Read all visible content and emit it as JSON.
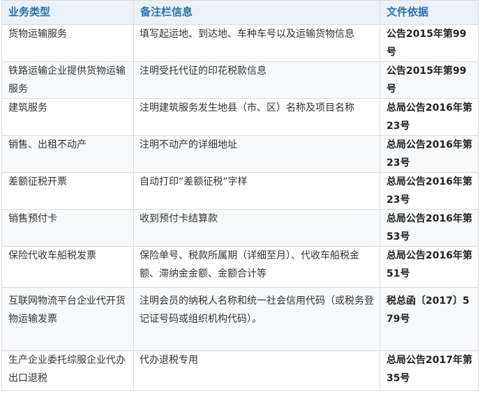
{
  "table": {
    "headers": [
      "业务类型",
      "备注栏信息",
      "文件依据"
    ],
    "rows": [
      {
        "type": "货物运输服务",
        "note": "填写起运地、到达地、车种车号以及运输货物信息",
        "basis": "公告2015年第99号"
      },
      {
        "type": "铁路运输企业提供货物运输服务",
        "note": "注明受托代征的印花税款信息",
        "basis": "公告2015年第99号"
      },
      {
        "type": "建筑服务",
        "note": "注明建筑服务发生地县（市、区）名称及项目名称",
        "basis": "总局公告2016年第23号"
      },
      {
        "type": "销售、出租不动产",
        "note": "注明不动产的详细地址",
        "basis": "总局公告2016年第23号"
      },
      {
        "type": "差额征税开票",
        "note": "自动打印“差额征税”字样",
        "basis": "总局公告2016年第23号"
      },
      {
        "type": "销售预付卡",
        "note": "收到预付卡结算款",
        "basis": "总局公告2016年第53号"
      },
      {
        "type": "保险代收车船税发票",
        "note": "保险单号、税款所属期（详细至月）、代收车船税金额、滞纳金金额、金额合计等",
        "basis": "总局公告2016年第51号"
      },
      {
        "type": "互联网物流平台企业代开货物运输发票",
        "note": "注明会员的纳税人名称和统一社会信用代码（或税务登记证号码或组织机构代码）。",
        "basis": "税总函〔2017〕579号"
      },
      {
        "type": "生产企业委托综服企业代办出口退税",
        "note": "代办退税专用",
        "basis": "总局公告2017年第35号"
      }
    ]
  }
}
